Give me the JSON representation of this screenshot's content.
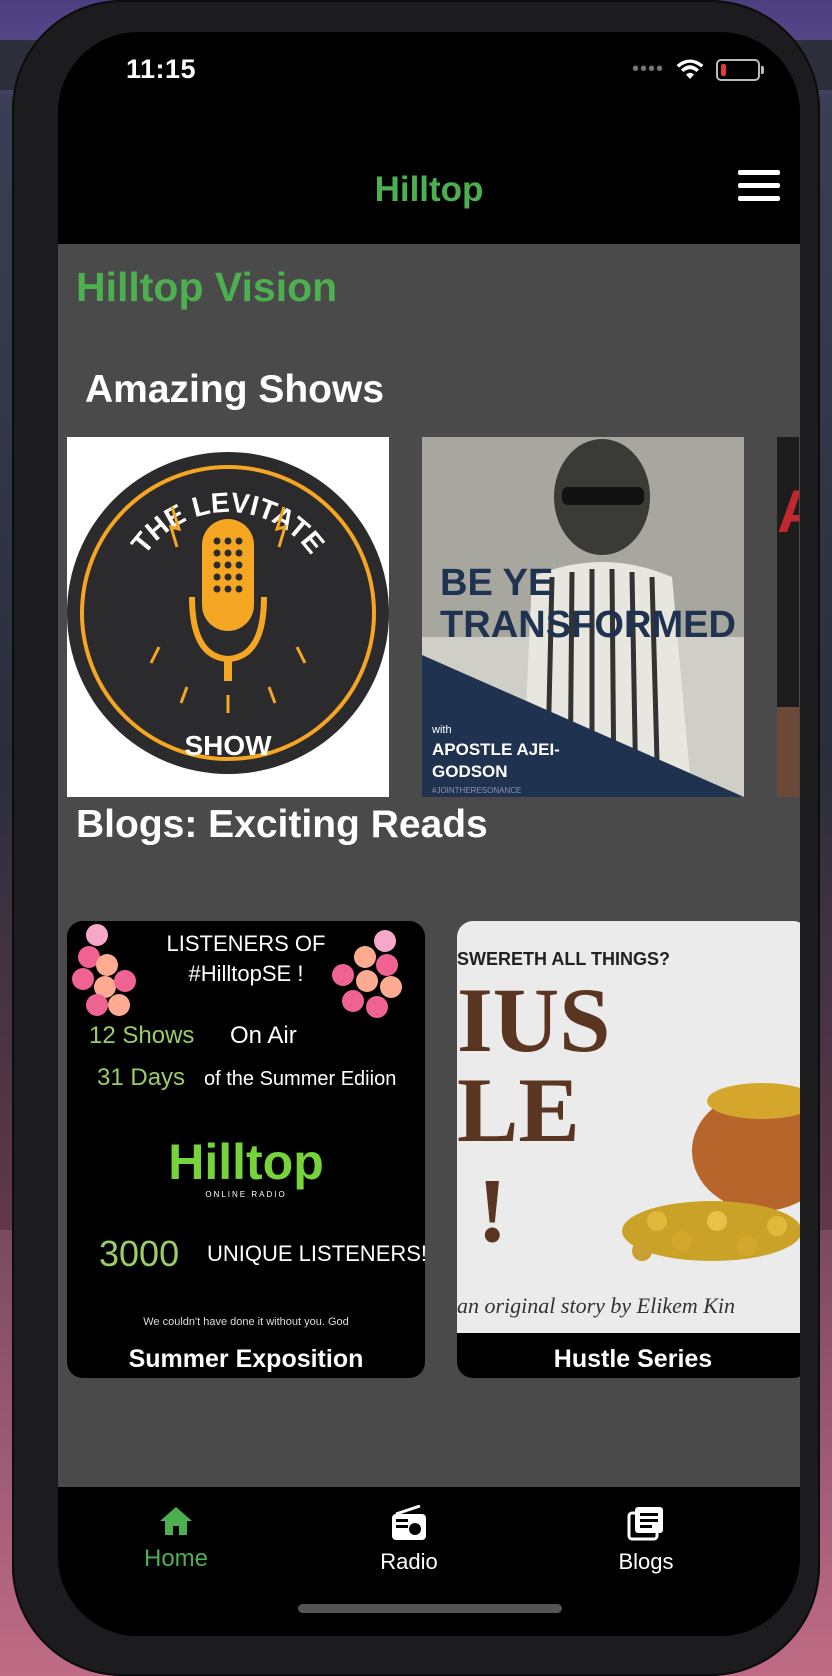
{
  "status_bar": {
    "time": "11:15",
    "dots": "••••"
  },
  "header": {
    "title": "Hilltop"
  },
  "main": {
    "vision_title": "Hilltop Vision",
    "shows_title": "Amazing Shows",
    "shows": [
      {
        "top_text": "THE LEVITATE",
        "bottom_text": "SHOW"
      },
      {
        "title_line1": "BE YE",
        "title_line2": "TRANSFORMED",
        "with": "with",
        "host_line1": "APOSTLE AJEI-",
        "host_line2": "GODSON",
        "hashtag": "#JOINTHERESONANCE"
      },
      {
        "partial_text": "A"
      }
    ],
    "blogs_title": "Blogs: Exciting Reads",
    "blogs": [
      {
        "caption": "Summer Exposition",
        "line1": "LISTENERS OF",
        "line2": "#HilltopSE !",
        "shows": "12 Shows",
        "days": "31 Days",
        "onair": "On Air",
        "edition": "of the Summer Ediion",
        "logo": "Hilltop",
        "logo_sub": "ONLINE RADIO",
        "count": "3000",
        "unique": "UNIQUE LISTENERS!",
        "thanks": "We couldn't have done it without you. God"
      },
      {
        "caption": "Hustle Series",
        "top": "SWERETH ALL THINGS?",
        "big1": "IUS",
        "big2": "LE",
        "big3": "!",
        "byline": "an original story by Elikem Kin"
      }
    ]
  },
  "tabbar": {
    "home": "Home",
    "radio": "Radio",
    "blogs": "Blogs"
  },
  "colors": {
    "accent": "#4caf50",
    "content_bg": "#4a4a4a",
    "bar_bg": "#000000"
  },
  "icons": [
    "wifi-icon",
    "battery-icon",
    "menu-icon",
    "home-icon",
    "radio-icon",
    "blogs-icon",
    "microphone-icon"
  ]
}
